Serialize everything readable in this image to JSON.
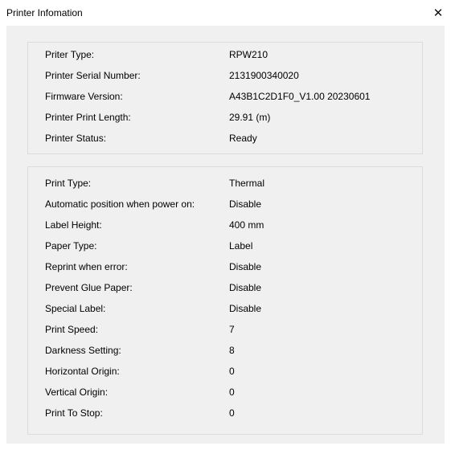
{
  "window": {
    "title": "Printer Infomation",
    "close_glyph": "✕"
  },
  "printer_info": [
    {
      "label": "Priter Type:",
      "value": "RPW210"
    },
    {
      "label": "Printer Serial Number:",
      "value": "2131900340020"
    },
    {
      "label": "Firmware Version:",
      "value": "A43B1C2D1F0_V1.00 20230601"
    },
    {
      "label": "Printer Print Length:",
      "value": "29.91 (m)"
    },
    {
      "label": "Printer Status:",
      "value": "Ready"
    }
  ],
  "settings": [
    {
      "label": "Print Type:",
      "value": "Thermal"
    },
    {
      "label": "Automatic position when power on:",
      "value": "Disable"
    },
    {
      "label": "Label Height:",
      "value": "400 mm"
    },
    {
      "label": "Paper Type:",
      "value": "Label"
    },
    {
      "label": "Reprint when error:",
      "value": "Disable"
    },
    {
      "label": "Prevent Glue Paper:",
      "value": "Disable"
    },
    {
      "label": "Special Label:",
      "value": "Disable"
    },
    {
      "label": "Print Speed:",
      "value": "7"
    },
    {
      "label": "Darkness Setting:",
      "value": "8"
    },
    {
      "label": "Horizontal Origin:",
      "value": "0"
    },
    {
      "label": "Vertical Origin:",
      "value": "0"
    },
    {
      "label": "Print To Stop:",
      "value": "0"
    }
  ]
}
